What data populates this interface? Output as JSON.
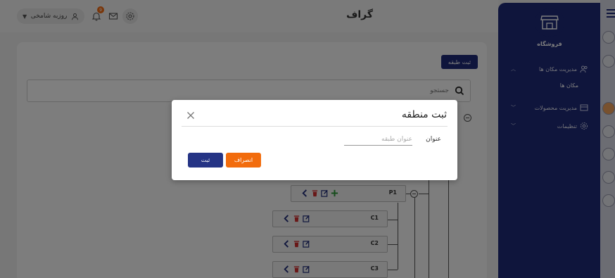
{
  "header": {
    "page_title": "گراف",
    "user_name": "روزبه شامخی",
    "notification_count": "9"
  },
  "toolbar": {
    "add_class_label": "ثبت طبقه"
  },
  "search": {
    "placeholder": "جستجو"
  },
  "tree": {
    "nodes": [
      {
        "label": "P1"
      },
      {
        "label": "C1"
      },
      {
        "label": "C2"
      },
      {
        "label": "C3"
      }
    ]
  },
  "sidebar": {
    "store_name": "فروشگاه",
    "items": [
      {
        "label": "مدیریت مکان ها",
        "icon": "users-icon"
      },
      {
        "label": "مکان ها"
      },
      {
        "label": "مدیریت محصولات",
        "icon": "store-icon"
      },
      {
        "label": "تنظیمات",
        "icon": "gear-icon"
      }
    ]
  },
  "modal": {
    "title": "ثبت منطقه",
    "field_label": "عنوان",
    "field_placeholder": "عنوان طبقه",
    "field_value": "",
    "cancel_label": "انصراف",
    "submit_label": "ثبت"
  },
  "colors": {
    "primary": "#1e2a78",
    "accent": "#f26c0d",
    "delete": "#d32f2f",
    "add": "#2e9a3a"
  }
}
